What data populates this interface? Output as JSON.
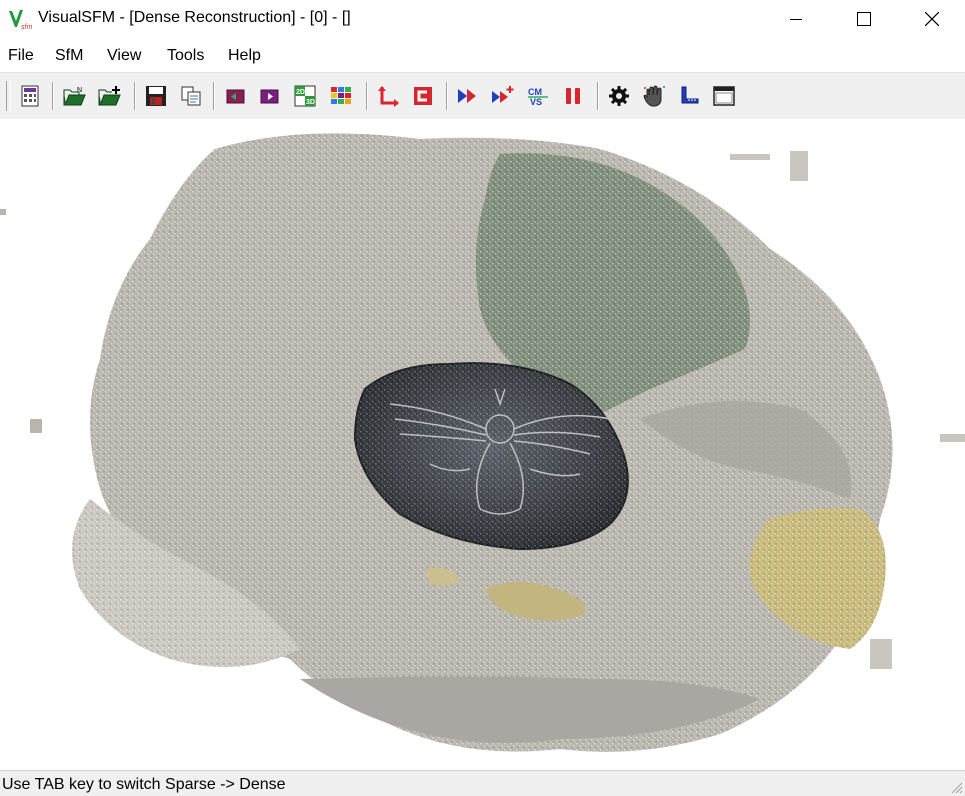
{
  "window": {
    "title": "VisualSFM - [Dense Reconstruction] - [0] - []",
    "logo_icon": "visualsfm-logo-icon",
    "controls": [
      "minimize-icon",
      "maximize-icon",
      "close-icon"
    ]
  },
  "menu": {
    "file": "File",
    "sfm": "SfM",
    "view": "View",
    "tools": "Tools",
    "help": "Help"
  },
  "toolbar": {
    "buttons": [
      "log-window-icon",
      "open-multiple-images-icon",
      "add-images-icon",
      "save-nvm-icon",
      "copy-icon",
      "previous-image-icon",
      "next-image-icon",
      "switch-2d-3d-icon",
      "thumbnails-icon",
      "compute-missing-matches-icon",
      "show-match-matrix-icon",
      "compute-3d-reconstruction-icon",
      "add-reconstruction-icon",
      "run-cmvs-icon",
      "pause-icon",
      "settings-icon",
      "pan-hand-icon",
      "measure-icon",
      "window-icon"
    ]
  },
  "colors": {
    "toolbar_bg": "#f0f0f0",
    "statusbar_bg": "#f0f0f0",
    "canvas_bg": "#ffffff",
    "point_cloud_gray": "#b5b2aa",
    "point_cloud_green": "#7e8c7a",
    "point_cloud_yellow": "#c8b97a",
    "stone_dark": "#3c4046"
  },
  "status": {
    "text": "Use TAB key to switch Sparse -> Dense"
  }
}
